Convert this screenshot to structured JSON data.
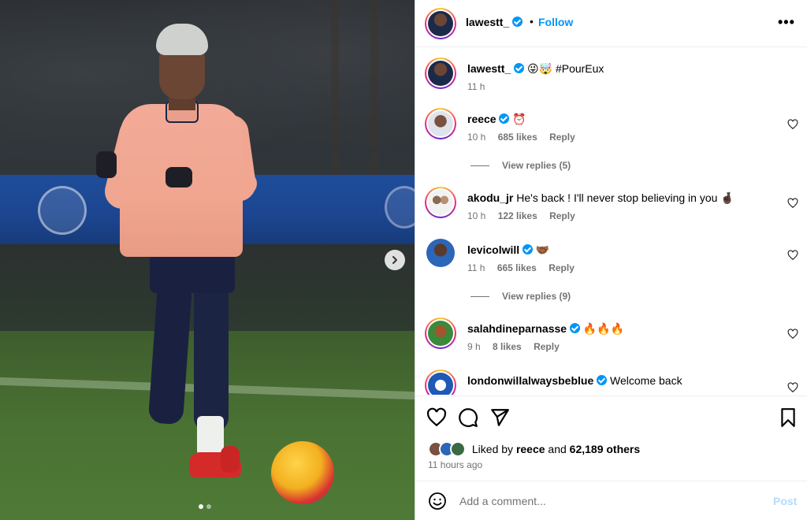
{
  "post": {
    "author": "lawestt_",
    "follow_label": "Follow",
    "more_label": "•••",
    "caption": "😜🤯 #PourEux",
    "caption_time": "11 h"
  },
  "comments": [
    {
      "user": "reece",
      "text": "⏰",
      "time": "10 h",
      "likes": "685 likes",
      "reply": "Reply",
      "verified": true
    },
    {
      "user": "akodu_jr",
      "text": "He's back ! I'll never stop believing in you 🤞🏿",
      "time": "10 h",
      "likes": "122 likes",
      "reply": "Reply",
      "verified": false
    },
    {
      "user": "levicolwill",
      "text": "🤝🏾",
      "time": "11 h",
      "likes": "665 likes",
      "reply": "Reply",
      "verified": true
    },
    {
      "user": "salahdineparnasse",
      "text": "🔥🔥🔥",
      "time": "9 h",
      "likes": "8 likes",
      "reply": "Reply",
      "verified": true
    },
    {
      "user": "londonwillalwaysbeblue",
      "text": "Welcome back",
      "verified": true
    }
  ],
  "view_replies": [
    "View replies (5)",
    "View replies (9)"
  ],
  "likes": {
    "prefix": "Liked by",
    "user": "reece",
    "and": "and",
    "count": "62,189 others",
    "time_ago": "11 hours ago"
  },
  "composer": {
    "placeholder": "Add a comment...",
    "post_label": "Post"
  },
  "colors": {
    "accent": "#0095f6",
    "post_disabled": "#b3dbff",
    "muted": "#737373"
  },
  "icons": {
    "like": "heart-icon",
    "comment": "comment-icon",
    "share": "share-icon",
    "save": "bookmark-icon",
    "emoji": "emoji-icon",
    "next": "chevron-right-icon"
  }
}
